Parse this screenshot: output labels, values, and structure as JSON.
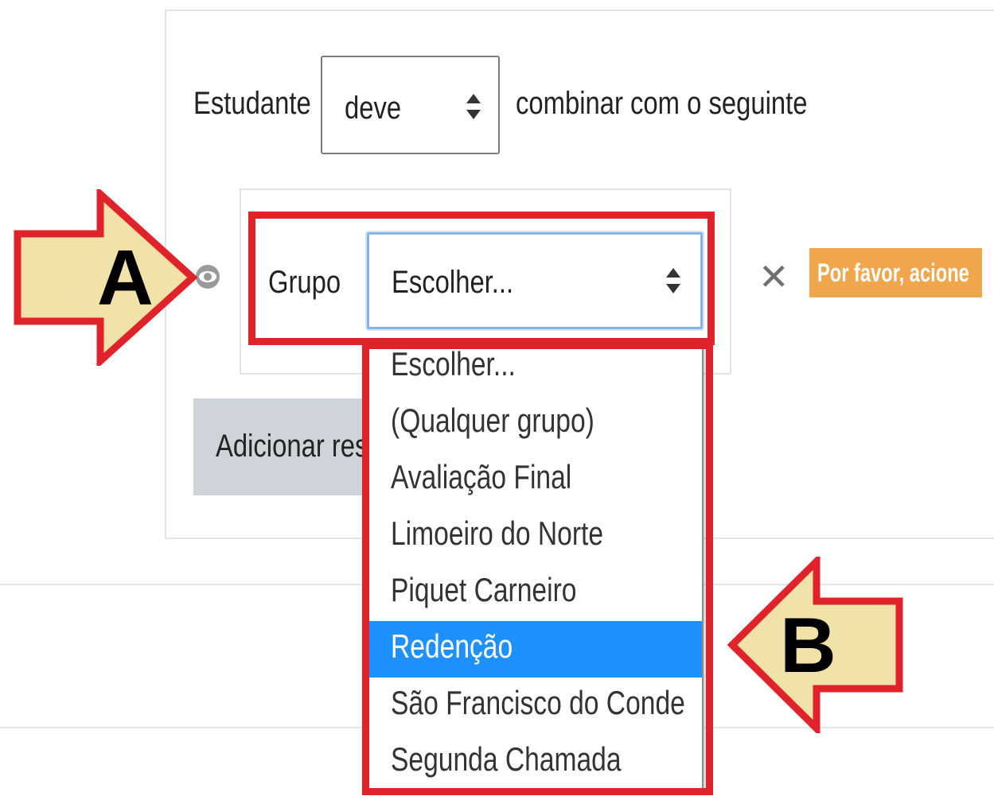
{
  "rule": {
    "subject_label": "Estudante",
    "condition_select_value": "deve",
    "suffix_text": "combinar com o seguinte"
  },
  "condition": {
    "field_label": "Grupo",
    "select_value": "Escolher...",
    "warning_badge": "Por favor, acione"
  },
  "add_button_label": "Adicionar res",
  "dropdown": {
    "options": [
      "Escolher...",
      "(Qualquer grupo)",
      "Avaliação Final",
      "Limoeiro do Norte",
      "Piquet Carneiro",
      "Redenção",
      "São Francisco do Conde",
      "Segunda Chamada"
    ],
    "highlighted": "Redenção"
  },
  "annotations": {
    "callout_a": "A",
    "callout_b": "B",
    "arrow_fill": "#f0e2a8",
    "arrow_outline": "#e0222b"
  },
  "icons": {
    "visibility": "eye-icon",
    "remove": "close-icon",
    "select_arrows": "updown-arrows-icon"
  },
  "colors": {
    "highlight": "#1e90ff",
    "badge": "#f0a64a",
    "button": "#ced4da",
    "focus": "#8ab4e8"
  }
}
